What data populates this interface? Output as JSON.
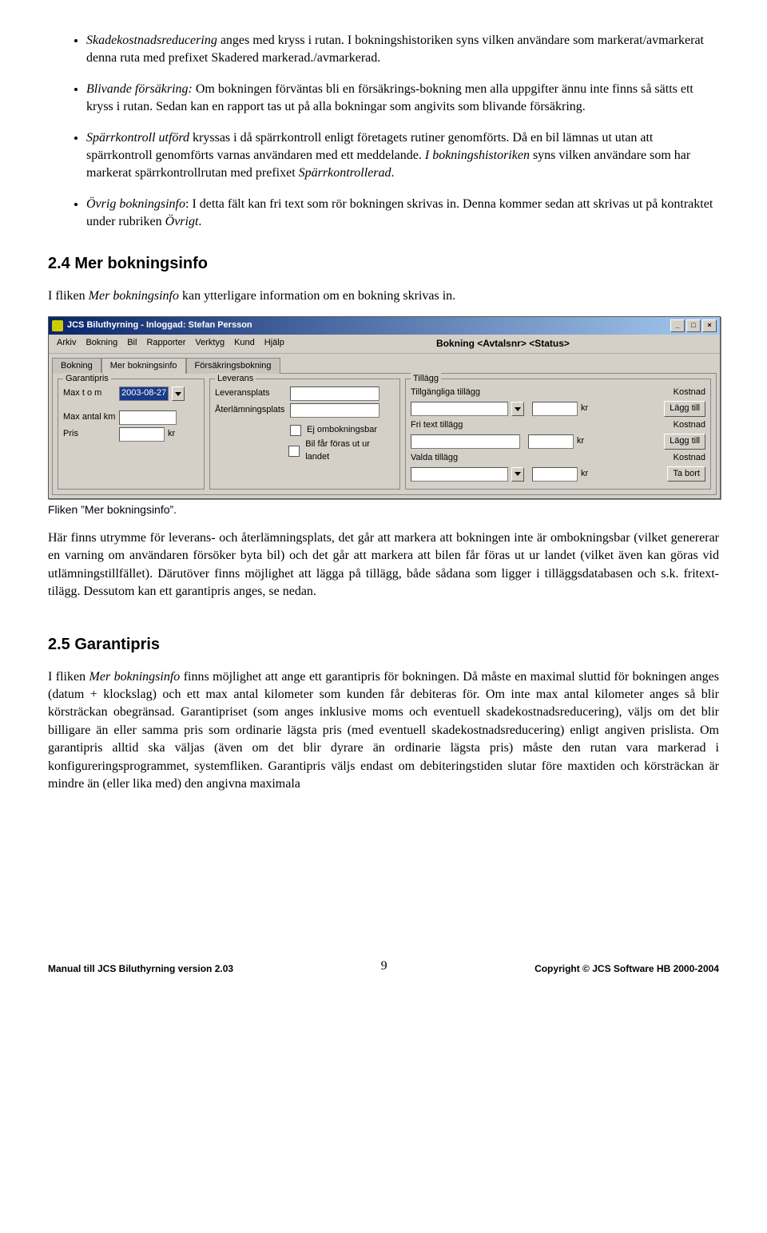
{
  "bullets": {
    "b1a": "Skadekostnadsreducering",
    "b1b": " anges med kryss i rutan. I bokningshistoriken syns vilken användare som markerat/avmarkerat denna ruta med prefixet Skadered markerad./avmarkerad.",
    "b2a": "Blivande försäkring:",
    "b2b": " Om bokningen förväntas bli en försäkrings-bokning men alla uppgifter ännu inte finns så sätts ett kryss i rutan. Sedan kan en rapport tas ut på alla bokningar som angivits som blivande försäkring.",
    "b3a": "Spärrkontroll utförd",
    "b3b": " kryssas i då spärrkontroll enligt företagets rutiner genomförts. Då en bil lämnas ut utan att spärrkontroll genomförts varnas användaren med ett meddelande. ",
    "b3c": "I bokningshistoriken",
    "b3d": " syns vilken användare som har markerat spärrkontrollrutan med prefixet ",
    "b3e": "Spärrkontrollerad",
    "b3f": ".",
    "b4a": "Övrig bokningsinfo",
    "b4b": ": I detta fält kan fri text som rör bokningen skrivas in. Denna kommer sedan att skrivas ut på kontraktet under rubriken ",
    "b4c": "Övrigt",
    "b4d": "."
  },
  "section24": "2.4 Mer bokningsinfo",
  "p24_1a": "I fliken ",
  "p24_1b": "Mer bokningsinfo",
  "p24_1c": " kan ytterligare information om en bokning skrivas in.",
  "win": {
    "title": "JCS Biluthyrning - Inloggad: Stefan Persson",
    "menus": [
      "Arkiv",
      "Bokning",
      "Bil",
      "Rapporter",
      "Verktyg",
      "Kund",
      "Hjälp"
    ],
    "centerTitle": "Bokning <Avtalsnr> <Status>",
    "tabs": [
      "Bokning",
      "Mer bokningsinfo",
      "Försäkringsbokning"
    ],
    "garantipris": {
      "legend": "Garantipris",
      "maxtom": "Max t o m",
      "date": "2003-08-27",
      "maxkm": "Max antal km",
      "pris": "Pris",
      "kr": "kr"
    },
    "leverans": {
      "legend": "Leverans",
      "levplats": "Leveransplats",
      "aterplats": "Återlämningsplats",
      "ejombok": "Ej ombokningsbar",
      "bilutland": "Bil får föras ut ur landet"
    },
    "tillagg": {
      "legend": "Tillägg",
      "tillg": "Tillgängliga tillägg",
      "kostnad": "Kostnad",
      "kr": "kr",
      "laggtill": "Lägg till",
      "fritext": "Fri text tillägg",
      "valda": "Valda tillägg",
      "tabort": "Ta bort"
    }
  },
  "caption": "Fliken ”Mer bokningsinfo”.",
  "p24_2": "Här finns utrymme för leverans- och återlämningsplats, det går att markera att bokningen inte är ombokningsbar (vilket genererar en varning om användaren försöker byta bil) och det går att markera att bilen får föras ut ur landet (vilket även kan göras vid utlämningstillfället). Därutöver finns möjlighet att lägga på tillägg, både sådana som ligger i tilläggsdatabasen och s.k. fritext-tilägg. Dessutom kan ett garantipris anges, se nedan.",
  "section25": "2.5 Garantipris",
  "p25_1a": "I fliken ",
  "p25_1b": "Mer bokningsinfo",
  "p25_1c": " finns möjlighet att ange ett garantipris för bokningen. Då måste en maximal sluttid för bokningen anges (datum + klockslag) och ett max antal kilometer som kunden får debiteras för. Om inte max antal kilometer anges så blir körsträckan obegränsad. Garantipriset (som anges inklusive moms och eventuell skadekostnadsreducering), väljs om det blir billigare än eller samma pris som ordinarie lägsta pris (med eventuell skadekostnadsreducering) enligt angiven prislista. Om garantipris alltid ska väljas (även om det blir dyrare än ordinarie lägsta pris) måste den rutan vara markerad i konfigureringsprogrammet, systemfliken. Garantipris väljs endast om debiteringstiden slutar före maxtiden och körsträckan är mindre än (eller lika med) den angivna maximala",
  "footer": {
    "left": "Manual till JCS Biluthyrning version 2.03",
    "page": "9",
    "right": "Copyright © JCS Software HB 2000-2004"
  }
}
